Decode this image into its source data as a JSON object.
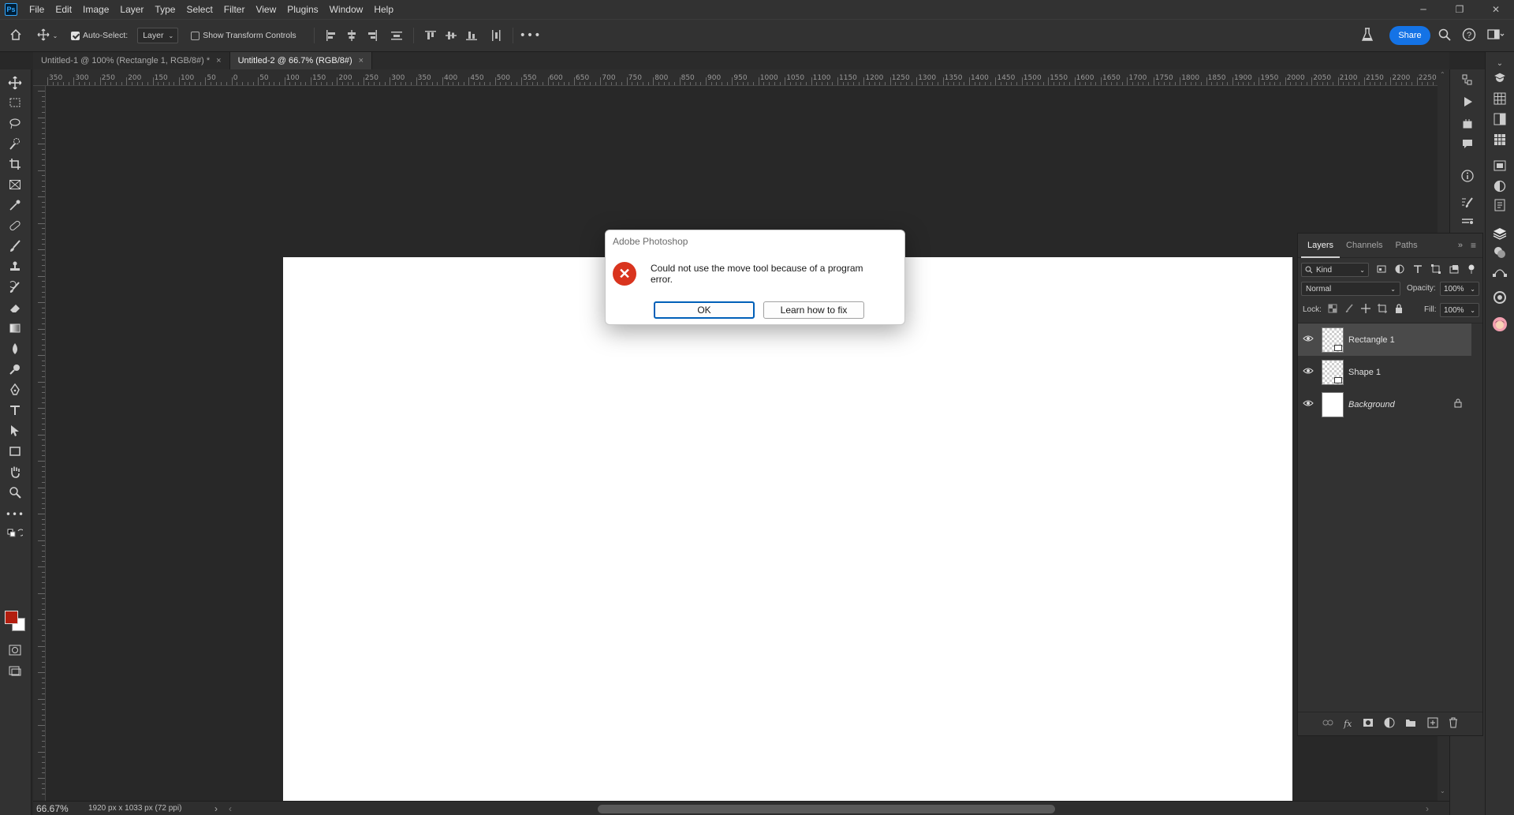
{
  "app": {
    "logo": "Ps",
    "menu": [
      "File",
      "Edit",
      "Image",
      "Layer",
      "Type",
      "Select",
      "Filter",
      "View",
      "Plugins",
      "Window",
      "Help"
    ],
    "window_controls": {
      "minimize": "─",
      "restore": "❐",
      "close": "✕"
    }
  },
  "options": {
    "auto_select_label": "Auto-Select:",
    "auto_select_checked": true,
    "auto_select_target": "Layer",
    "show_transform_label": "Show Transform Controls",
    "show_transform_checked": false,
    "more": "•••",
    "share_label": "Share"
  },
  "tabs": [
    {
      "label": "Untitled-1 @ 100% (Rectangle 1, RGB/8#) *",
      "close": "×",
      "active": false
    },
    {
      "label": "Untitled-2 @ 66.7% (RGB/8#)",
      "close": "×",
      "active": true
    }
  ],
  "ruler": {
    "labels": [
      "350",
      "300",
      "250",
      "200",
      "150",
      "100",
      "50",
      "0",
      "50",
      "100",
      "150",
      "200",
      "250",
      "300",
      "350",
      "400",
      "450",
      "500",
      "550",
      "600",
      "650",
      "700",
      "750",
      "800",
      "850",
      "900",
      "950",
      "1000",
      "1050",
      "1100",
      "1150",
      "1200",
      "1250",
      "1300",
      "1350",
      "1400",
      "1450",
      "1500",
      "1550",
      "1600",
      "1650",
      "1700",
      "1750",
      "1800",
      "1850",
      "1900",
      "1950",
      "2000",
      "2050",
      "2100",
      "2150",
      "2200",
      "2250"
    ]
  },
  "dialog": {
    "title": "Adobe Photoshop",
    "icon": "✕",
    "message": "Could not use the move tool because of a program error.",
    "ok_label": "OK",
    "learn_label": "Learn how to fix"
  },
  "status": {
    "zoom": "66.67%",
    "doc_info": "1920 px x 1033 px (72 ppi)",
    "next": "›",
    "prev": "‹"
  },
  "layers_panel": {
    "tabs": [
      "Layers",
      "Channels",
      "Paths"
    ],
    "filter_kind": "Kind",
    "blend_mode": "Normal",
    "opacity_label": "Opacity:",
    "opacity_value": "100%",
    "lock_label": "Lock:",
    "fill_label": "Fill:",
    "fill_value": "100%",
    "layers": [
      {
        "name": "Rectangle 1",
        "selected": true,
        "italic": false,
        "locked": false
      },
      {
        "name": "Shape 1",
        "selected": false,
        "italic": false,
        "locked": false
      },
      {
        "name": "Background",
        "selected": false,
        "italic": true,
        "locked": true
      }
    ],
    "footer_fx": "fx"
  },
  "colors": {
    "foreground": "#b31e0f",
    "background": "#ffffff",
    "accent": "#1473e6",
    "error": "#d9341e"
  }
}
